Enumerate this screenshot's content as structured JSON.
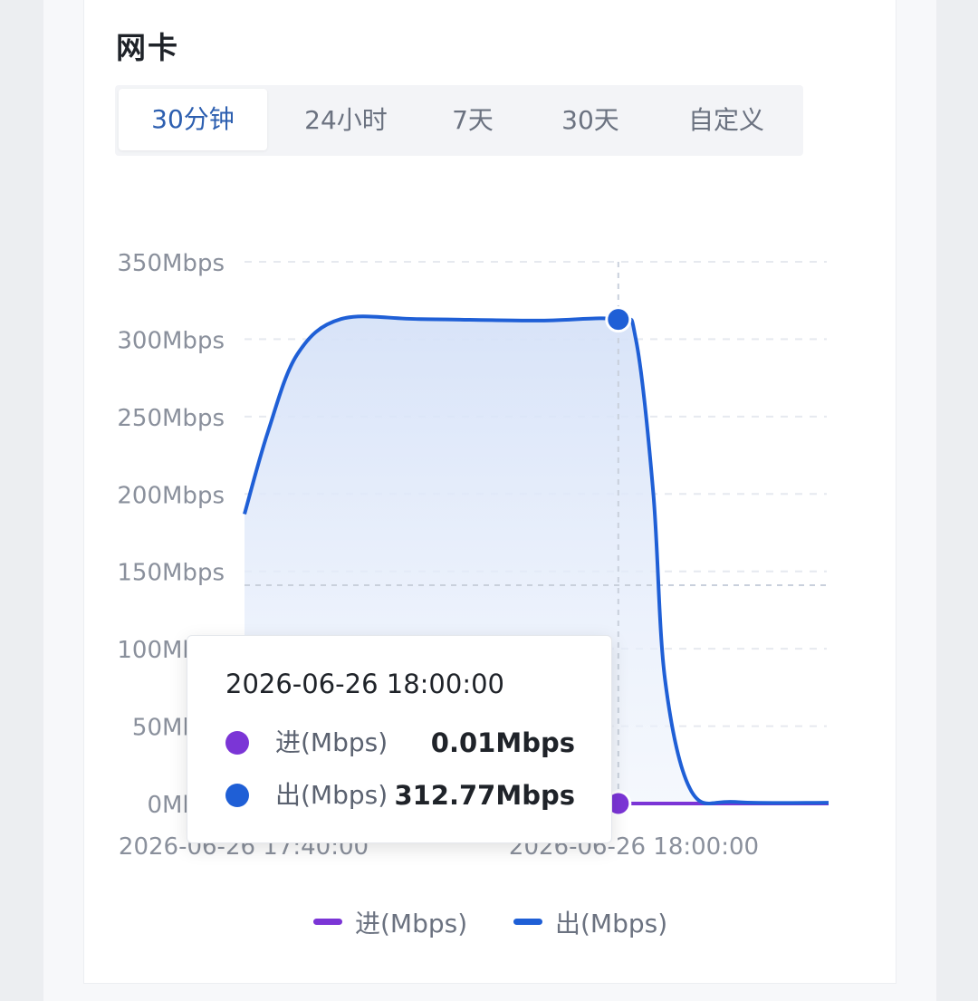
{
  "card": {
    "title": "网卡"
  },
  "tabs": [
    {
      "label": "30分钟",
      "active": true
    },
    {
      "label": "24小时",
      "active": false
    },
    {
      "label": "7天",
      "active": false
    },
    {
      "label": "30天",
      "active": false
    },
    {
      "label": "自定义",
      "active": false
    }
  ],
  "colors": {
    "in": "#7b35d6",
    "out": "#1f5fd6",
    "active_tab": "#2d5fb0"
  },
  "chart_data": {
    "type": "area",
    "y_ticks": [
      "0Mbps",
      "50Mbps",
      "100Mbps",
      "150Mbps",
      "200Mbps",
      "250Mbps",
      "300Mbps",
      "350Mbps"
    ],
    "ylim": [
      0,
      350
    ],
    "x_ticks": [
      "2026-06-26 17:40:00",
      "2026-06-26 18:00:00"
    ],
    "series": [
      {
        "name": "进(Mbps)",
        "points": [
          [
            0.0,
            0
          ],
          [
            0.5,
            0
          ],
          [
            0.64,
            0.01
          ],
          [
            1.0,
            0
          ]
        ]
      },
      {
        "name": "出(Mbps)",
        "points": [
          [
            0.0,
            187
          ],
          [
            0.04,
            240
          ],
          [
            0.09,
            290
          ],
          [
            0.165,
            313
          ],
          [
            0.3,
            313
          ],
          [
            0.5,
            312
          ],
          [
            0.64,
            312.77
          ],
          [
            0.67,
            300
          ],
          [
            0.7,
            200
          ],
          [
            0.72,
            80
          ],
          [
            0.765,
            8
          ],
          [
            0.84,
            1
          ],
          [
            1.0,
            0.5
          ]
        ]
      }
    ],
    "grid": true,
    "legend_position": "bottom-center"
  },
  "tooltip": {
    "time": "2026-06-26 18:00:00",
    "rows": [
      {
        "name": "进(Mbps)",
        "value": "0.01Mbps"
      },
      {
        "name": "出(Mbps)",
        "value": "312.77Mbps"
      }
    ]
  },
  "legend": [
    {
      "label": "进(Mbps)"
    },
    {
      "label": "出(Mbps)"
    }
  ]
}
